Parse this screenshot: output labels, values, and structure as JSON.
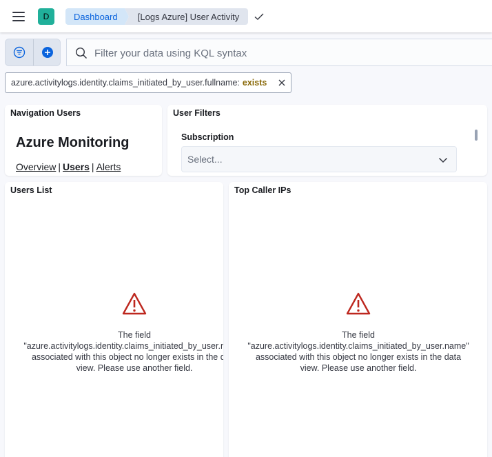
{
  "header": {
    "avatar_letter": "D",
    "breadcrumbs": [
      "Dashboard",
      "[Logs Azure] User Activity"
    ]
  },
  "query": {
    "placeholder": "Filter your data using KQL syntax"
  },
  "filter_pill": {
    "field": "azure.activitylogs.identity.claims_initiated_by_user.fullname:",
    "operator": "exists"
  },
  "panels": {
    "navigation": {
      "title": "Navigation Users",
      "heading": "Azure Monitoring",
      "links": [
        "Overview",
        "Users",
        "Alerts"
      ],
      "separator": "|"
    },
    "user_filters": {
      "title": "User Filters",
      "subscription_label": "Subscription",
      "select_placeholder": "Select..."
    },
    "users_list": {
      "title": "Users List",
      "error_lines": [
        "The field",
        "\"azure.activitylogs.identity.claims_initiated_by_user.name\"",
        "associated with this object no longer exists in the data",
        "view. Please use another field."
      ]
    },
    "top_caller_ips": {
      "title": "Top Caller IPs",
      "error_lines": [
        "The field",
        "\"azure.activitylogs.identity.claims_initiated_by_user.name\"",
        "associated with this object no longer exists in the data",
        "view. Please use another field."
      ]
    }
  },
  "colors": {
    "accent": "#0b64dd",
    "avatar": "#20b09a",
    "warning": "#bd271e",
    "exists": "#8a6a0a"
  },
  "icons": [
    "menu-icon",
    "check-icon",
    "filter-menu-icon",
    "add-filter-icon",
    "search-icon",
    "close-icon",
    "chevron-down-icon",
    "warning-icon"
  ]
}
